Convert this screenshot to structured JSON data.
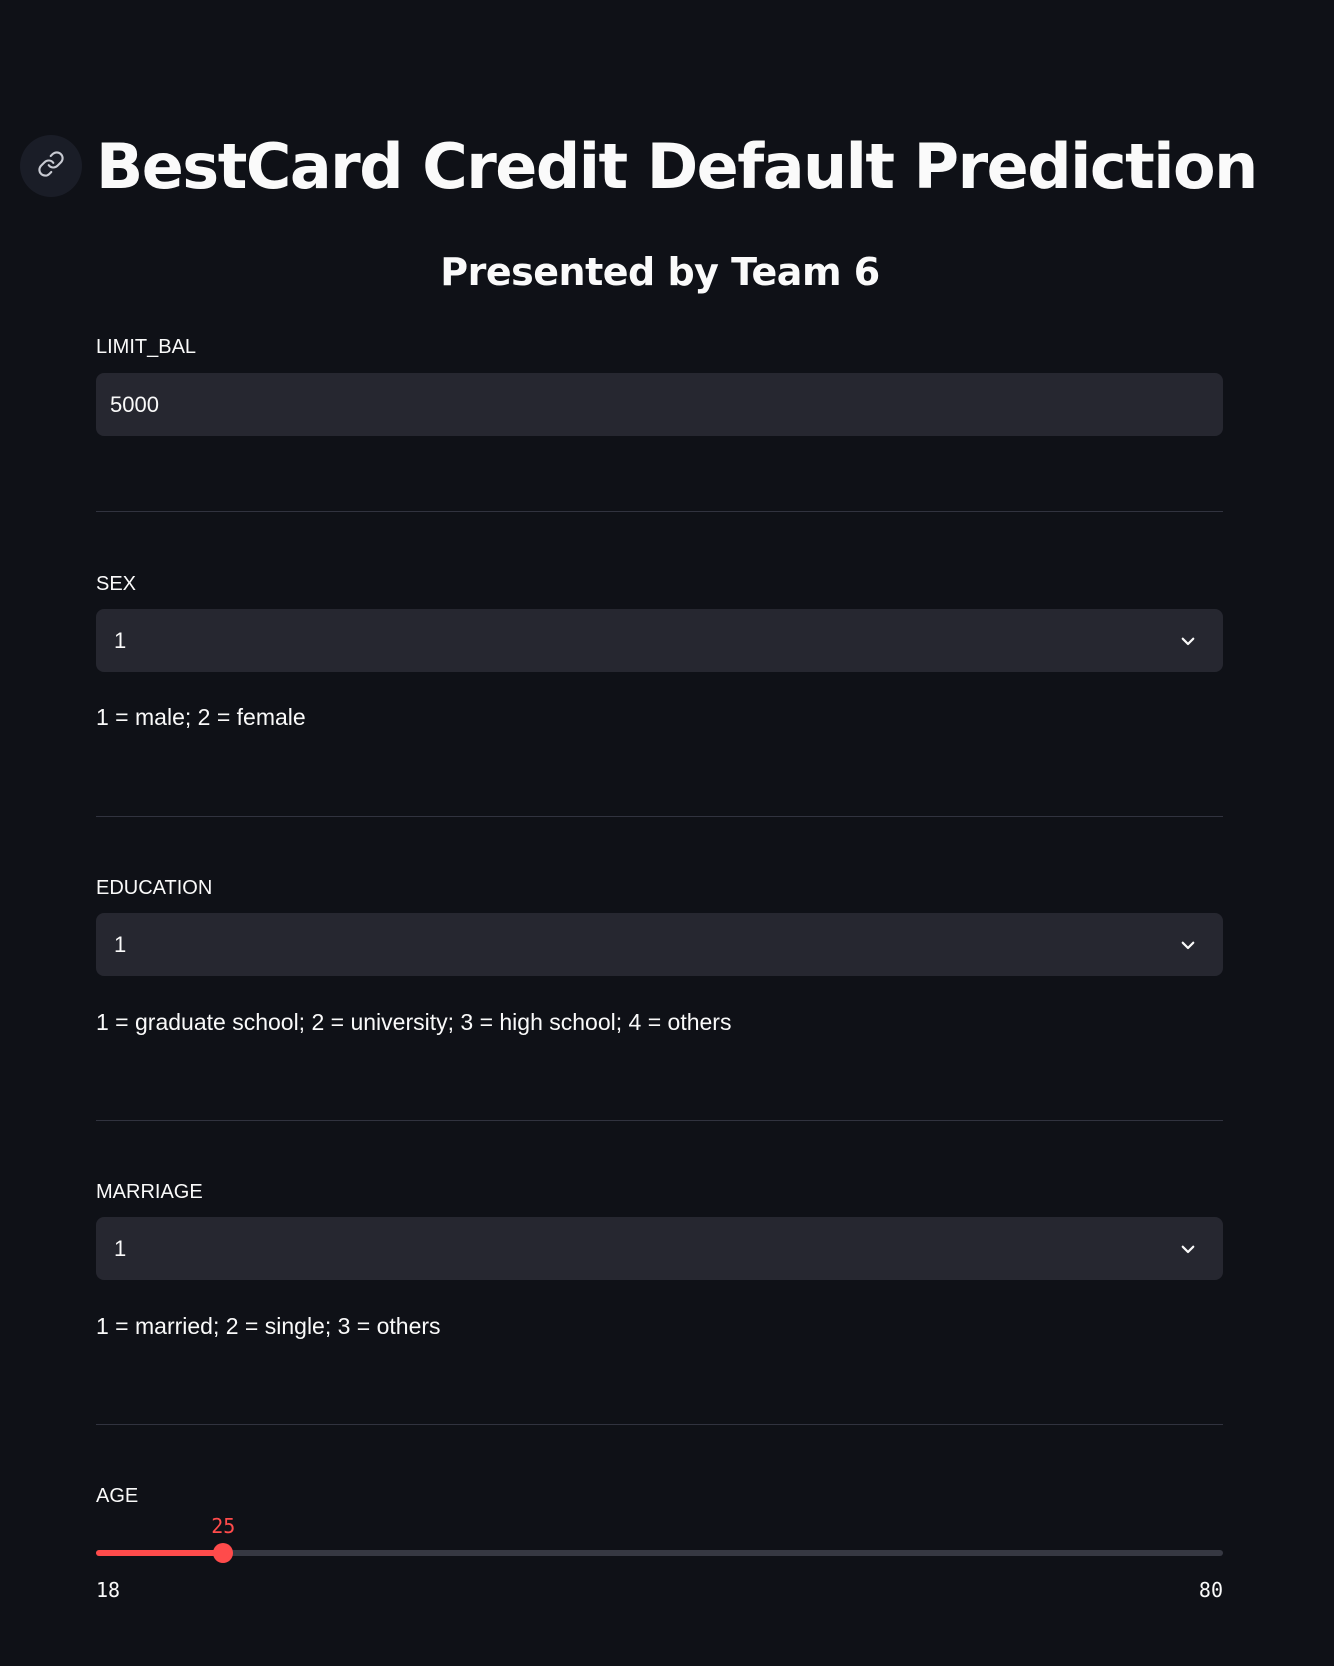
{
  "header": {
    "title": "BestCard Credit Default Prediction",
    "subtitle": "Presented by Team 6",
    "anchor_icon": "link-icon"
  },
  "fields": {
    "limit_bal": {
      "label": "LIMIT_BAL",
      "value": "5000"
    },
    "sex": {
      "label": "SEX",
      "value": "1",
      "help": "1 = male; 2 = female"
    },
    "education": {
      "label": "EDUCATION",
      "value": "1",
      "help": "1 = graduate school; 2 = university; 3 = high school; 4 = others"
    },
    "marriage": {
      "label": "MARRIAGE",
      "value": "1",
      "help": "1 = married; 2 = single; 3 = others"
    },
    "age": {
      "label": "AGE",
      "value": 25,
      "min": 18,
      "max": 80
    }
  },
  "colors": {
    "background": "#0f1117",
    "input_background": "#262730",
    "accent": "#ff4b4b",
    "text": "#fafafa",
    "divider": "#31333f"
  }
}
